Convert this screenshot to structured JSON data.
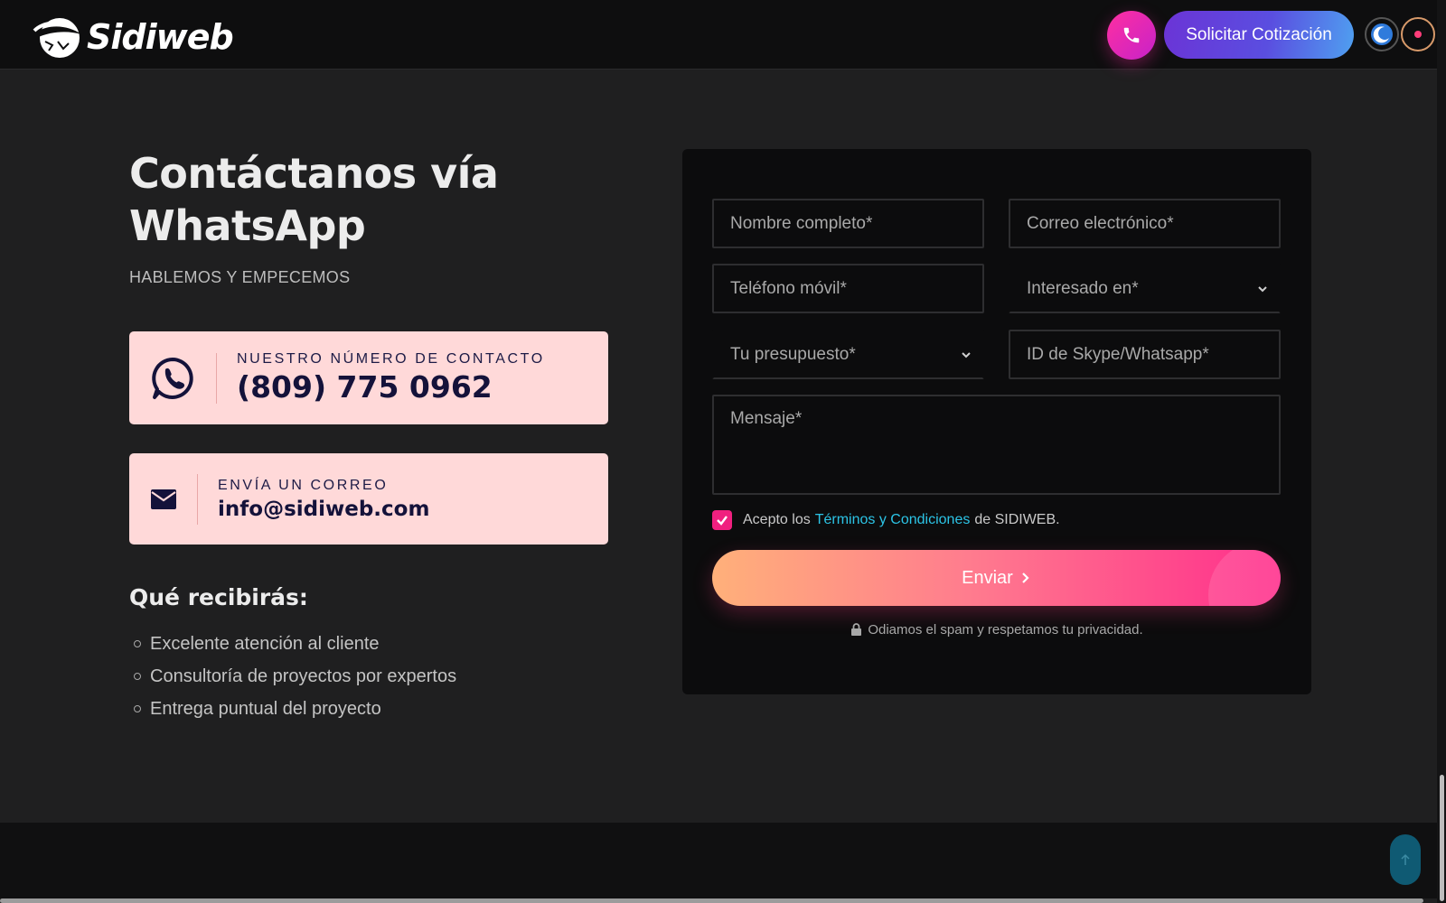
{
  "header": {
    "logo_text": "Sidiweb",
    "quote_button": "Solicitar Cotización"
  },
  "hero": {
    "title_line1": "Contáctanos vía",
    "title_line2": "WhatsApp",
    "subtitle": "HABLEMOS Y EMPECEMOS"
  },
  "contact": {
    "phone_label": "NUESTRO NÚMERO DE CONTACTO",
    "phone_value": "(809) 775 0962",
    "mail_label": "ENVÍA UN CORREO",
    "mail_value": "info@sidiweb.com"
  },
  "benefits": {
    "title": "Qué recibirás:",
    "items": [
      "Excelente atención al cliente",
      "Consultoría de proyectos por expertos",
      "Entrega puntual del proyecto"
    ]
  },
  "form": {
    "name_placeholder": "Nombre completo*",
    "email_placeholder": "Correo electrónico*",
    "phone_placeholder": "Teléfono móvil*",
    "interest_selected": "Interesado en*",
    "budget_selected": "Tu presupuesto*",
    "skype_placeholder": "ID de Skype/Whatsapp*",
    "message_placeholder": "Mensaje*",
    "terms_prefix": "Acepto los",
    "terms_link": "Términos y Condiciones",
    "terms_suffix": "de SIDIWEB.",
    "terms_checked": true,
    "submit_label": "Enviar",
    "privacy_note": "Odiamos el spam y respetamos tu privacidad."
  },
  "colors": {
    "accent_pink": "#f0207f",
    "link_cyan": "#2cc4e6",
    "card_bg": "#ffd9d9",
    "quote_purple": "#6b34d6"
  },
  "icons": [
    "logo-mark-icon",
    "phone-icon",
    "moon-icon",
    "record-icon",
    "whatsapp-icon",
    "envelope-icon",
    "chevron-down-icon",
    "check-icon",
    "chevron-right-icon",
    "lock-icon",
    "arrow-up-icon"
  ]
}
